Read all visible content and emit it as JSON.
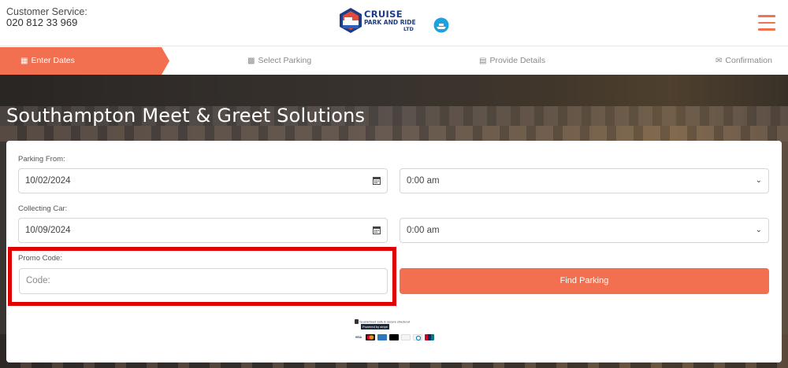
{
  "header": {
    "customer_service_label": "Customer Service:",
    "phone": "020 812 33 969",
    "logo": {
      "line1": "CRUISE",
      "line2": "PARK AND RIDE",
      "line3": "LTD"
    }
  },
  "steps": [
    {
      "label": "Enter Dates",
      "icon": "calendar-icon",
      "active": true
    },
    {
      "label": "Select Parking",
      "icon": "car-icon",
      "active": false
    },
    {
      "label": "Provide Details",
      "icon": "id-card-icon",
      "active": false
    },
    {
      "label": "Confirmation",
      "icon": "envelope-open-icon",
      "active": false
    }
  ],
  "hero": {
    "title": "Southampton Meet & Greet Solutions"
  },
  "form": {
    "parking_from_label": "Parking From:",
    "parking_from_date": "10/02/2024",
    "parking_from_time": "0:00 am",
    "collecting_label": "Collecting Car:",
    "collecting_date": "10/09/2024",
    "collecting_time": "0:00 am",
    "promo_label": "Promo Code:",
    "promo_placeholder": "Code:",
    "find_button": "Find Parking"
  },
  "footer": {
    "secure_text": "Guaranteed safe & secure checkout",
    "powered_by": "Powered by stripe",
    "payment_methods": [
      "VISA",
      "Mastercard",
      "AMEX",
      "Apple Pay",
      "Discover",
      "Diners",
      "UnionPay"
    ]
  },
  "colors": {
    "accent": "#f26f4f",
    "highlight": "#e00000",
    "logo_blue": "#1f3c88"
  }
}
